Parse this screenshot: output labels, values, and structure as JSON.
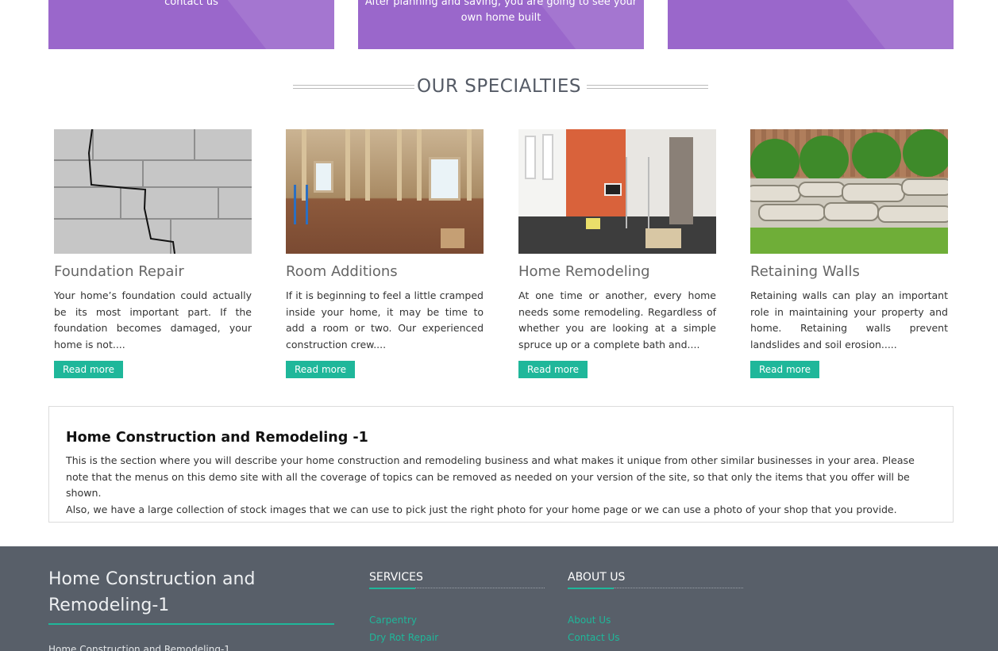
{
  "promos": {
    "card1_text": "contact us",
    "card2_text": "After planning and saving, you are going to see your own home built",
    "card3_text": ""
  },
  "specialties": {
    "heading": "OUR SPECIALTIES",
    "items": [
      {
        "title": "Foundation Repair",
        "text": "Your home’s foundation could actually be its most important part. If the foundation becomes damaged, your home is not....",
        "button": "Read more",
        "image": "cracked-cinder-block-wall"
      },
      {
        "title": "Room Additions",
        "text": "If it is beginning to feel a little cramped inside your home, it may be time to add a room or two. Our experienced construction crew....",
        "button": "Read more",
        "image": "framed-room-under-construction"
      },
      {
        "title": "Home Remodeling",
        "text": "At one time or another, every home needs some remodeling. Regardless of whether you are looking at a simple spruce up or a complete bath and....",
        "button": "Read more",
        "image": "room-being-painted-orange"
      },
      {
        "title": "Retaining Walls",
        "text": "Retaining walls can play an important role in maintaining your property and home. Retaining walls prevent landslides and soil erosion.....",
        "button": "Read more",
        "image": "stone-retaining-wall-with-shrubs"
      }
    ]
  },
  "about": {
    "title": "Home Construction and Remodeling -1",
    "para1": "This is the section where you will describe your home construction and remodeling business and what makes it unique from other similar businesses in your area. Please note that the menus on this demo site with all the coverage of topics can be removed as needed on your version of the site, so that only the items that you offer will be shown.",
    "para2": "Also, we have a large collection of stock images that we can use to pick just the right photo for your home page or we can use a photo of your shop that you provide."
  },
  "footer": {
    "brand_name": "Home Construction and Remodeling-1",
    "brand_sub": "Home Construction and Remodeling-1",
    "services_heading": "SERVICES",
    "services_links": [
      "Carpentry",
      "Dry Rot Repair"
    ],
    "about_heading": "ABOUT US",
    "about_links": [
      "About Us",
      "Contact Us"
    ]
  },
  "colors": {
    "promo_purple": "#9a67cb",
    "accent_teal": "#1fb79a",
    "footer_bg": "#585f69"
  }
}
